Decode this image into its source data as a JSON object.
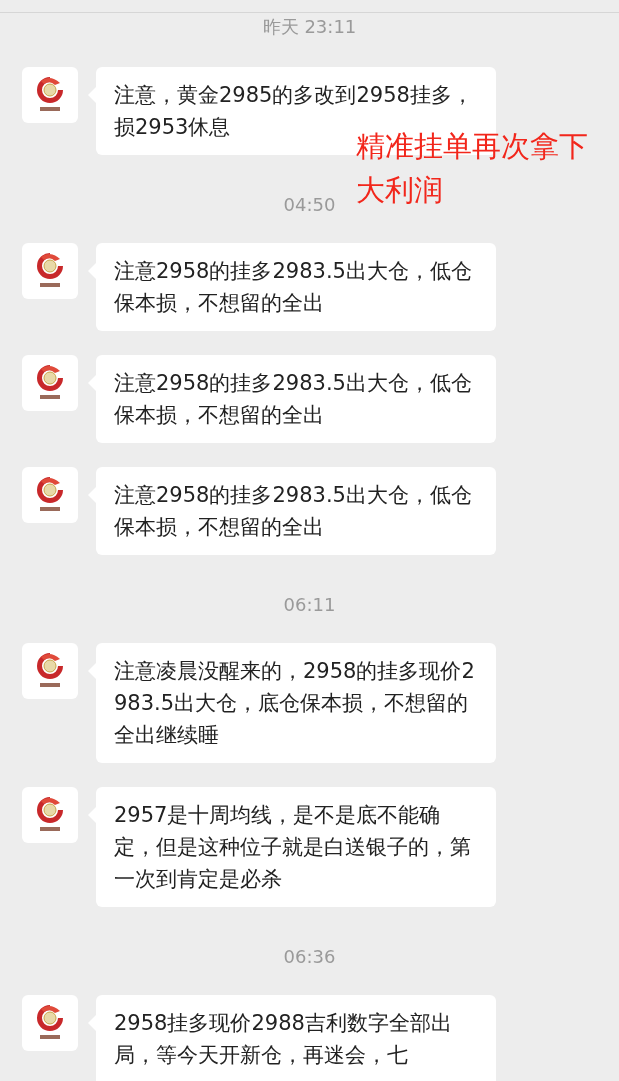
{
  "chat": [
    {
      "kind": "time",
      "text": "昨天 23:11"
    },
    {
      "kind": "message",
      "text": "注意，黄金2985的多改到2958挂多，损2953休息"
    },
    {
      "kind": "time",
      "text": "04:50"
    },
    {
      "kind": "message",
      "text": "注意2958的挂多2983.5出大仓，低仓保本损，不想留的全出"
    },
    {
      "kind": "message",
      "text": "注意2958的挂多2983.5出大仓，低仓保本损，不想留的全出"
    },
    {
      "kind": "message",
      "text": "注意2958的挂多2983.5出大仓，低仓保本损，不想留的全出"
    },
    {
      "kind": "time",
      "text": "06:11"
    },
    {
      "kind": "message",
      "text": "注意凌晨没醒来的，2958的挂多现价2983.5出大仓，底仓保本损，不想留的全出继续睡"
    },
    {
      "kind": "message",
      "text": "2957是十周均线，是不是底不能确定，但是这种位子就是白送银子的，第一次到肯定是必杀"
    },
    {
      "kind": "time",
      "text": "06:36"
    },
    {
      "kind": "message",
      "text": "2958挂多现价2988吉利数字全部出局，等今天开新仓，再迷会，七"
    }
  ],
  "annotation": "精准挂单再次拿下大利润"
}
